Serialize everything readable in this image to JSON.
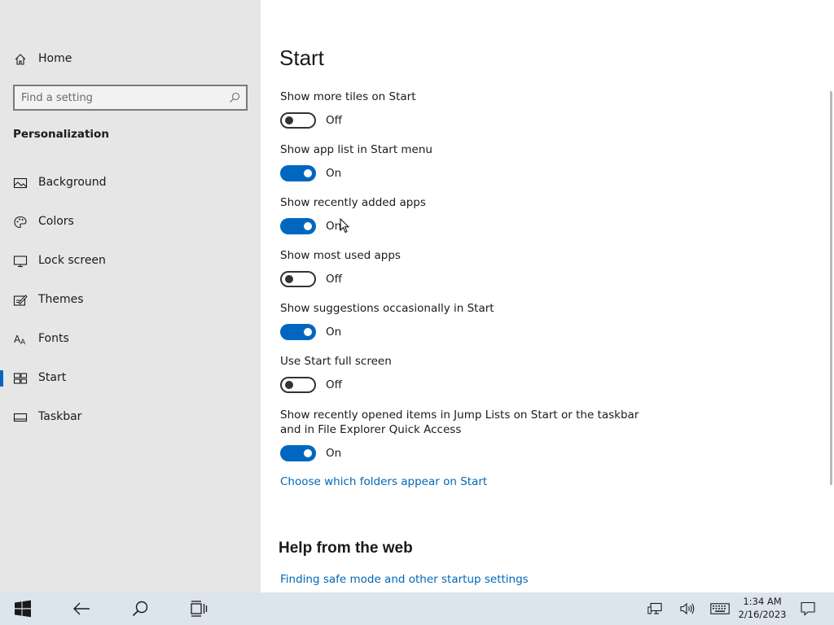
{
  "sidebar": {
    "home_label": "Home",
    "search_placeholder": "Find a setting",
    "section_title": "Personalization",
    "items": [
      {
        "label": "Background",
        "icon": "picture-icon"
      },
      {
        "label": "Colors",
        "icon": "palette-icon"
      },
      {
        "label": "Lock screen",
        "icon": "monitor-icon"
      },
      {
        "label": "Themes",
        "icon": "paintbrush-icon"
      },
      {
        "label": "Fonts",
        "icon": "font-icon"
      },
      {
        "label": "Start",
        "icon": "start-tiles-icon",
        "selected": true
      },
      {
        "label": "Taskbar",
        "icon": "taskbar-icon"
      }
    ]
  },
  "main": {
    "title": "Start",
    "settings": [
      {
        "label": "Show more tiles on Start",
        "state": "Off",
        "on": false
      },
      {
        "label": "Show app list in Start menu",
        "state": "On",
        "on": true
      },
      {
        "label": "Show recently added apps",
        "state": "On",
        "on": true
      },
      {
        "label": "Show most used apps",
        "state": "Off",
        "on": false
      },
      {
        "label": "Show suggestions occasionally in Start",
        "state": "On",
        "on": true
      },
      {
        "label": "Use Start full screen",
        "state": "Off",
        "on": false
      },
      {
        "label": "Show recently opened items in Jump Lists on Start or the taskbar and in File Explorer Quick Access",
        "state": "On",
        "on": true
      }
    ],
    "folders_link": "Choose which folders appear on Start",
    "help_title": "Help from the web",
    "help_link": "Finding safe mode and other startup settings"
  },
  "taskbar": {
    "time": "1:34 AM",
    "date": "2/16/2023"
  },
  "colors": {
    "accent": "#0067c0",
    "link": "#0067b8",
    "sidebar_bg": "#e6e6e6",
    "taskbar_bg": "#dce4ec"
  }
}
